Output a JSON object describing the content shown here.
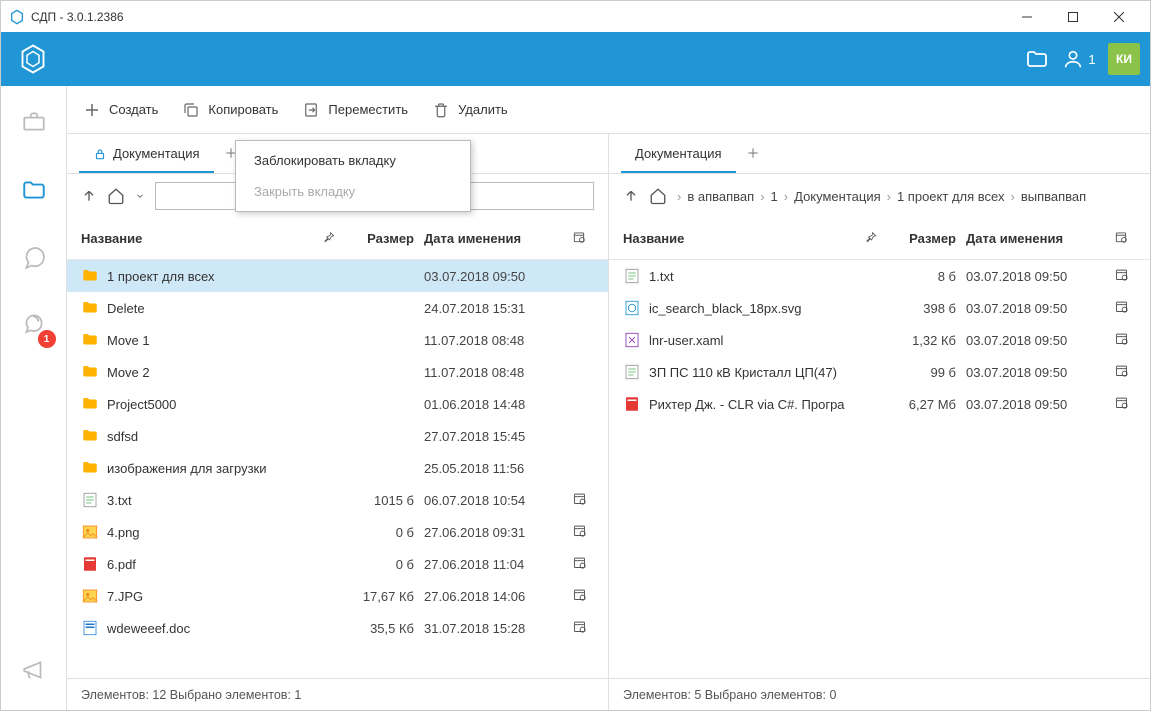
{
  "window": {
    "title": "СДП - 3.0.1.2386"
  },
  "appbar": {
    "user_count": "1",
    "avatar": "КИ"
  },
  "sidebar": {
    "badge": "1"
  },
  "toolbar": {
    "create": "Создать",
    "copy": "Копировать",
    "move": "Переместить",
    "delete": "Удалить"
  },
  "context_menu": {
    "lock": "Заблокировать вкладку",
    "close": "Закрыть вкладку"
  },
  "left": {
    "tab": "Документация",
    "search_value": "",
    "headers": {
      "name": "Название",
      "size": "Размер",
      "date": "Дата именения"
    },
    "rows": [
      {
        "icon": "folder",
        "name": "1 проект для всех",
        "size": "",
        "date": "03.07.2018 09:50",
        "cal": false,
        "selected": true
      },
      {
        "icon": "folder",
        "name": "Delete",
        "size": "",
        "date": "24.07.2018 15:31",
        "cal": false
      },
      {
        "icon": "folder",
        "name": "Move 1",
        "size": "",
        "date": "11.07.2018 08:48",
        "cal": false
      },
      {
        "icon": "folder",
        "name": "Move 2",
        "size": "",
        "date": "11.07.2018 08:48",
        "cal": false
      },
      {
        "icon": "folder",
        "name": "Project5000",
        "size": "",
        "date": "01.06.2018 14:48",
        "cal": false
      },
      {
        "icon": "folder",
        "name": "sdfsd",
        "size": "",
        "date": "27.07.2018 15:45",
        "cal": false
      },
      {
        "icon": "folder",
        "name": "изображения для загрузки",
        "size": "",
        "date": "25.05.2018 11:56",
        "cal": false
      },
      {
        "icon": "txt",
        "name": "3.txt",
        "size": "1015 б",
        "date": "06.07.2018 10:54",
        "cal": true
      },
      {
        "icon": "img",
        "name": "4.png",
        "size": "0 б",
        "date": "27.06.2018 09:31",
        "cal": true
      },
      {
        "icon": "pdf",
        "name": "6.pdf",
        "size": "0 б",
        "date": "27.06.2018 11:04",
        "cal": true
      },
      {
        "icon": "img",
        "name": "7.JPG",
        "size": "17,67 Кб",
        "date": "27.06.2018 14:06",
        "cal": true
      },
      {
        "icon": "doc",
        "name": "wdeweeef.doc",
        "size": "35,5 Кб",
        "date": "31.07.2018 15:28",
        "cal": true
      }
    ],
    "status": "Элементов: 12  Выбрано элементов: 1"
  },
  "right": {
    "tab": "Документация",
    "crumbs": [
      "в апвапвап",
      "1",
      "Документация",
      "1 проект для всех",
      "выпвапвап"
    ],
    "headers": {
      "name": "Название",
      "size": "Размер",
      "date": "Дата именения"
    },
    "rows": [
      {
        "icon": "txt",
        "name": "1.txt",
        "size": "8 б",
        "date": "03.07.2018 09:50",
        "cal": true
      },
      {
        "icon": "svg",
        "name": "ic_search_black_18px.svg",
        "size": "398 б",
        "date": "03.07.2018 09:50",
        "cal": true
      },
      {
        "icon": "xaml",
        "name": "lnr-user.xaml",
        "size": "1,32 Кб",
        "date": "03.07.2018 09:50",
        "cal": true
      },
      {
        "icon": "txt",
        "name": "ЗП ПС 110 кВ Кристалл ЦП(47)",
        "size": "99 б",
        "date": "03.07.2018 09:50",
        "cal": true
      },
      {
        "icon": "pdf",
        "name": "Рихтер Дж. - CLR via C#. Програ",
        "size": "6,27 Мб",
        "date": "03.07.2018 09:50",
        "cal": true
      }
    ],
    "status": "Элементов: 5  Выбрано элементов: 0"
  }
}
